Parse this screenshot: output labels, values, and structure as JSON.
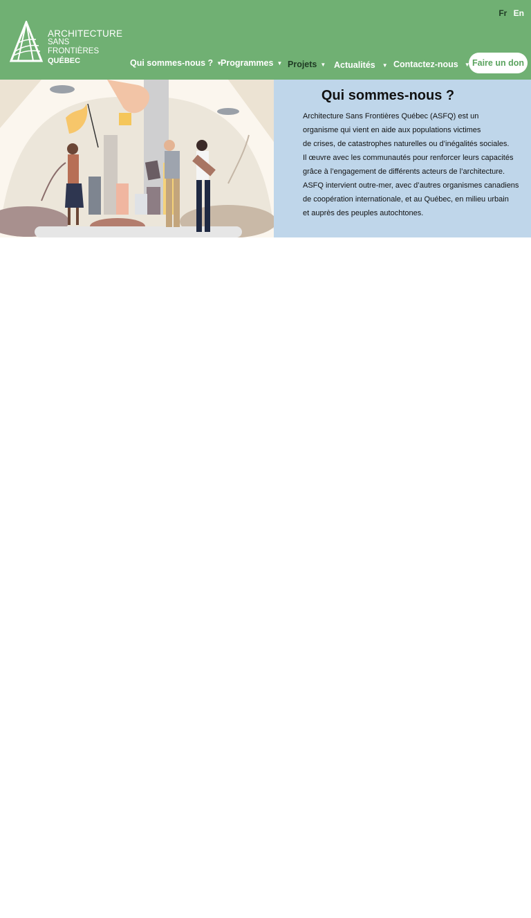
{
  "header": {
    "lang": {
      "fr": "Fr",
      "en": "En"
    },
    "logo": {
      "line1": "ARCHITECTURE",
      "line2": "SANS FRONTIÈRES",
      "line3": "QUÉBEC"
    },
    "nav": [
      {
        "label": "Qui sommes-nous ?"
      },
      {
        "label": "Programmes"
      },
      {
        "label": "Projets"
      },
      {
        "label": "Actualités"
      },
      {
        "label": "Contactez-nous"
      }
    ],
    "donate": "Faire un don",
    "colors": {
      "background": "#70b073",
      "active_text": "#1f3b24",
      "donate_text": "#5aa35e"
    }
  },
  "hero": {
    "title": "Qui sommes-nous ?",
    "lines": [
      "Architecture Sans Frontières Québec (ASFQ) est un",
      "organisme qui vient en aide aux populations victimes",
      " de crises, de catastrophes naturelles ou d’inégalités sociales.",
      "Il œuvre avec les communautés pour renforcer leurs capacités",
      "grâce à l’engagement de différents acteurs de l’architecture.",
      "ASFQ intervient outre-mer, avec d’autres organismes canadiens",
      "de coopération internationale, et au Québec, en milieu urbain",
      "et auprès des peuples autochtones."
    ],
    "panel_color": "#bfd6ea"
  }
}
